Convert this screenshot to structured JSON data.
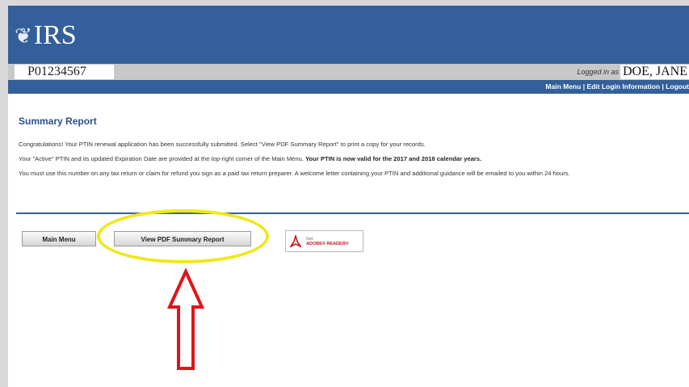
{
  "header": {
    "logo_text": "IRS",
    "logo_icon": "eagle-icon",
    "background_color": "#33609a"
  },
  "id_bar": {
    "ptin": "P01234567",
    "logged_in_label": "Logged in as",
    "user_name": "DOE, JANE"
  },
  "nav": {
    "main_menu": "Main Menu",
    "separator": " | ",
    "edit_login": "Edit Login Information",
    "logout": "Logout"
  },
  "page": {
    "title": "Summary Report",
    "para1": "Congratulations! Your PTIN renewal application has been successfully submitted. Select \"View PDF Summary Report\" to print a copy for your records.",
    "para2_normal": "Your \"Active\" PTIN and its updated Expiration Date are provided at the top-right corner of the Main Menu. ",
    "para2_bold": "Your PTIN is now valid for the 2017 and 2018 calendar years.",
    "para3": "You must use this number on any tax return or claim for refund you sign as a paid tax return preparer. A welcome letter containing your PTIN and additional guidance will be emailed to you within 24 hours."
  },
  "buttons": {
    "main_menu": "Main Menu",
    "view_pdf": "View PDF Summary Report"
  },
  "adobe_badge": {
    "line1": "Get",
    "line2": "ADOBE® READER®",
    "icon": "adobe-reader-icon"
  },
  "annotations": {
    "highlight_color": "#f0e81a",
    "arrow_color": "#e0141c"
  }
}
